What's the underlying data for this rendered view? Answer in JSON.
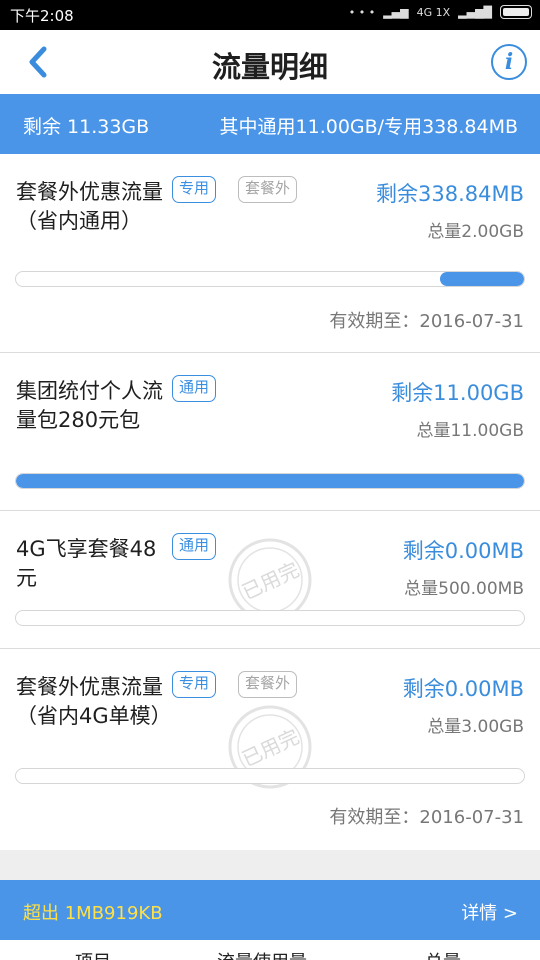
{
  "status_bar": {
    "time": "下午2:08",
    "network": "4G 1X"
  },
  "header": {
    "title": "流量明细"
  },
  "summary": {
    "remaining": "剩余 11.33GB",
    "breakdown": "其中通用11.00GB/专用338.84MB"
  },
  "packages": [
    {
      "name": "套餐外优惠流量（省内通用）",
      "tags": [
        "专用",
        "套餐外"
      ],
      "remaining": "剩余338.84MB",
      "total": "总量2.00GB",
      "remaining_fraction": 0.165,
      "expiry": "有效期至：2016-07-31",
      "used_up": false
    },
    {
      "name": "集团统付个人流量包280元包",
      "tags": [
        "通用"
      ],
      "remaining": "剩余11.00GB",
      "total": "总量11.00GB",
      "remaining_fraction": 1.0,
      "expiry": "",
      "used_up": false
    },
    {
      "name": "4G飞享套餐48元",
      "tags": [
        "通用"
      ],
      "remaining": "剩余0.00MB",
      "total": "总量500.00MB",
      "remaining_fraction": 0.0,
      "expiry": "",
      "used_up": true,
      "stamp_label": "已用完"
    },
    {
      "name": "套餐外优惠流量（省内4G单模）",
      "tags": [
        "专用",
        "套餐外"
      ],
      "remaining": "剩余0.00MB",
      "total": "总量3.00GB",
      "remaining_fraction": 0.0,
      "expiry": "有效期至：2016-07-31",
      "used_up": true,
      "stamp_label": "已用完"
    }
  ],
  "overage": {
    "label": "超出 1MB919KB",
    "detail_link": "详情 >"
  },
  "table_header": [
    "项目",
    "流量使用量",
    "总量"
  ],
  "colors": {
    "accent": "#4a95e8",
    "tag_blue": "#3b8fe0",
    "overage_yellow": "#ffe045"
  }
}
